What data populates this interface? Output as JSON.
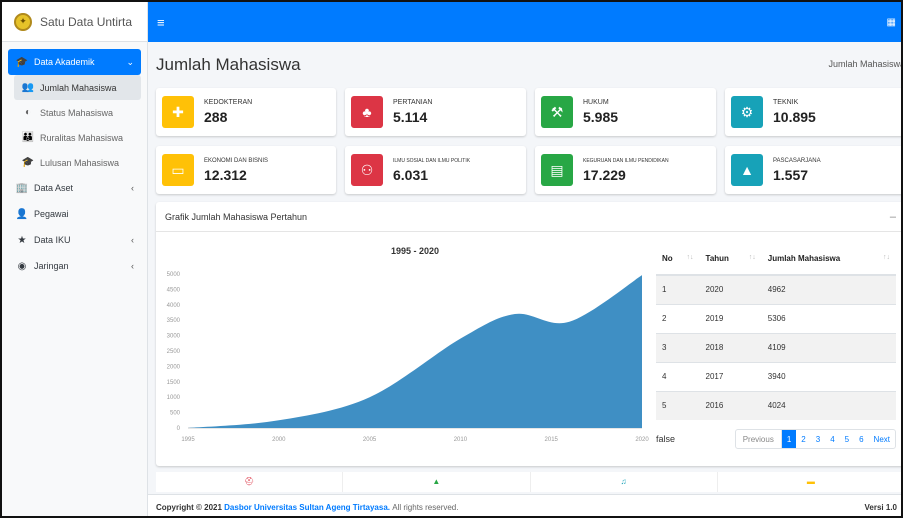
{
  "brand": {
    "title": "Satu Data Untirta"
  },
  "topbar": {
    "menu_icon": "hamburger-icon",
    "apps_icon": "grid-icon"
  },
  "sidebar": {
    "items": [
      {
        "label": "Data Akademik",
        "icon": "graduation-icon"
      },
      {
        "label": "Data Aset",
        "icon": "building-icon"
      },
      {
        "label": "Pegawai",
        "icon": "user-icon"
      },
      {
        "label": "Data IKU",
        "icon": "star-icon"
      },
      {
        "label": "Jaringan",
        "icon": "network-icon"
      }
    ],
    "sub_items": [
      {
        "label": "Jumlah Mahasiswa",
        "icon": "users-icon"
      },
      {
        "label": "Status Mahasiswa",
        "icon": "toggle-icon"
      },
      {
        "label": "Ruralitas Mahasiswa",
        "icon": "people-icon"
      },
      {
        "label": "Lulusan Mahasiswa",
        "icon": "cap-icon"
      }
    ]
  },
  "page": {
    "title": "Jumlah Mahasiswa",
    "breadcrumb": "Jumlah Mahasiswa"
  },
  "stats": [
    {
      "label": "KEDOKTERAN",
      "value": "288",
      "color": "#ffc107",
      "icon": "medkit-icon"
    },
    {
      "label": "PERTANIAN",
      "value": "5.114",
      "color": "#dc3545",
      "icon": "tree-icon"
    },
    {
      "label": "HUKUM",
      "value": "5.985",
      "color": "#28a745",
      "icon": "gavel-icon"
    },
    {
      "label": "TEKNIK",
      "value": "10.895",
      "color": "#17a2b8",
      "icon": "cogs-icon"
    },
    {
      "label": "EKONOMI DAN BISNIS",
      "value": "12.312",
      "color": "#ffc107",
      "icon": "money-icon"
    },
    {
      "label": "ILMU SOSIAL DAN ILMU POLITIK",
      "value": "6.031",
      "color": "#dc3545",
      "icon": "handshake-icon"
    },
    {
      "label": "KEGURUAN DAN ILMU PENDIDIKAN",
      "value": "17.229",
      "color": "#28a745",
      "icon": "book-icon"
    },
    {
      "label": "PASCASARJANA",
      "value": "1.557",
      "color": "#17a2b8",
      "icon": "graduation-icon"
    }
  ],
  "card": {
    "title": "Grafik Jumlah Mahasiswa Pertahun",
    "collapse": "–"
  },
  "chart_data": {
    "type": "area",
    "title": "1995 - 2020",
    "x": [
      1995,
      2000,
      2005,
      2010,
      2013,
      2016,
      2020
    ],
    "y": [
      0,
      250,
      1000,
      2900,
      3700,
      3450,
      4962
    ],
    "ylim": [
      0,
      5000
    ],
    "xlim": [
      1995,
      2020
    ],
    "yticks": [
      0,
      500,
      1000,
      1500,
      2000,
      2500,
      3000,
      3500,
      4000,
      4500,
      5000
    ],
    "xticks": [
      1995,
      2000,
      2005,
      2010,
      2015,
      2020
    ],
    "color": "#3f8fc4"
  },
  "table": {
    "headers": [
      "No",
      "Tahun",
      "Jumlah Mahasiswa"
    ],
    "rows": [
      [
        "1",
        "2020",
        "4962"
      ],
      [
        "2",
        "2019",
        "5306"
      ],
      [
        "3",
        "2018",
        "4109"
      ],
      [
        "4",
        "2017",
        "3940"
      ],
      [
        "5",
        "2016",
        "4024"
      ]
    ],
    "info": "false",
    "pager": {
      "previous": "Previous",
      "pages": [
        "1",
        "2",
        "3",
        "4",
        "5",
        "6"
      ],
      "next": "Next"
    }
  },
  "strip_icons": [
    {
      "icon": "medkit-icon",
      "glyph": "⛑",
      "color": "#dc3545"
    },
    {
      "icon": "cap-icon",
      "glyph": "▲",
      "color": "#28a745"
    },
    {
      "icon": "music-icon",
      "glyph": "♫",
      "color": "#17a2b8"
    },
    {
      "icon": "book-icon",
      "glyph": "▬",
      "color": "#ffc107"
    }
  ],
  "footer": {
    "prefix": "Copyright © 2021",
    "link": "Dasbor Universitas Sultan Ageng Tirtayasa.",
    "suffix": "All rights reserved.",
    "version": "Versi 1.0"
  }
}
